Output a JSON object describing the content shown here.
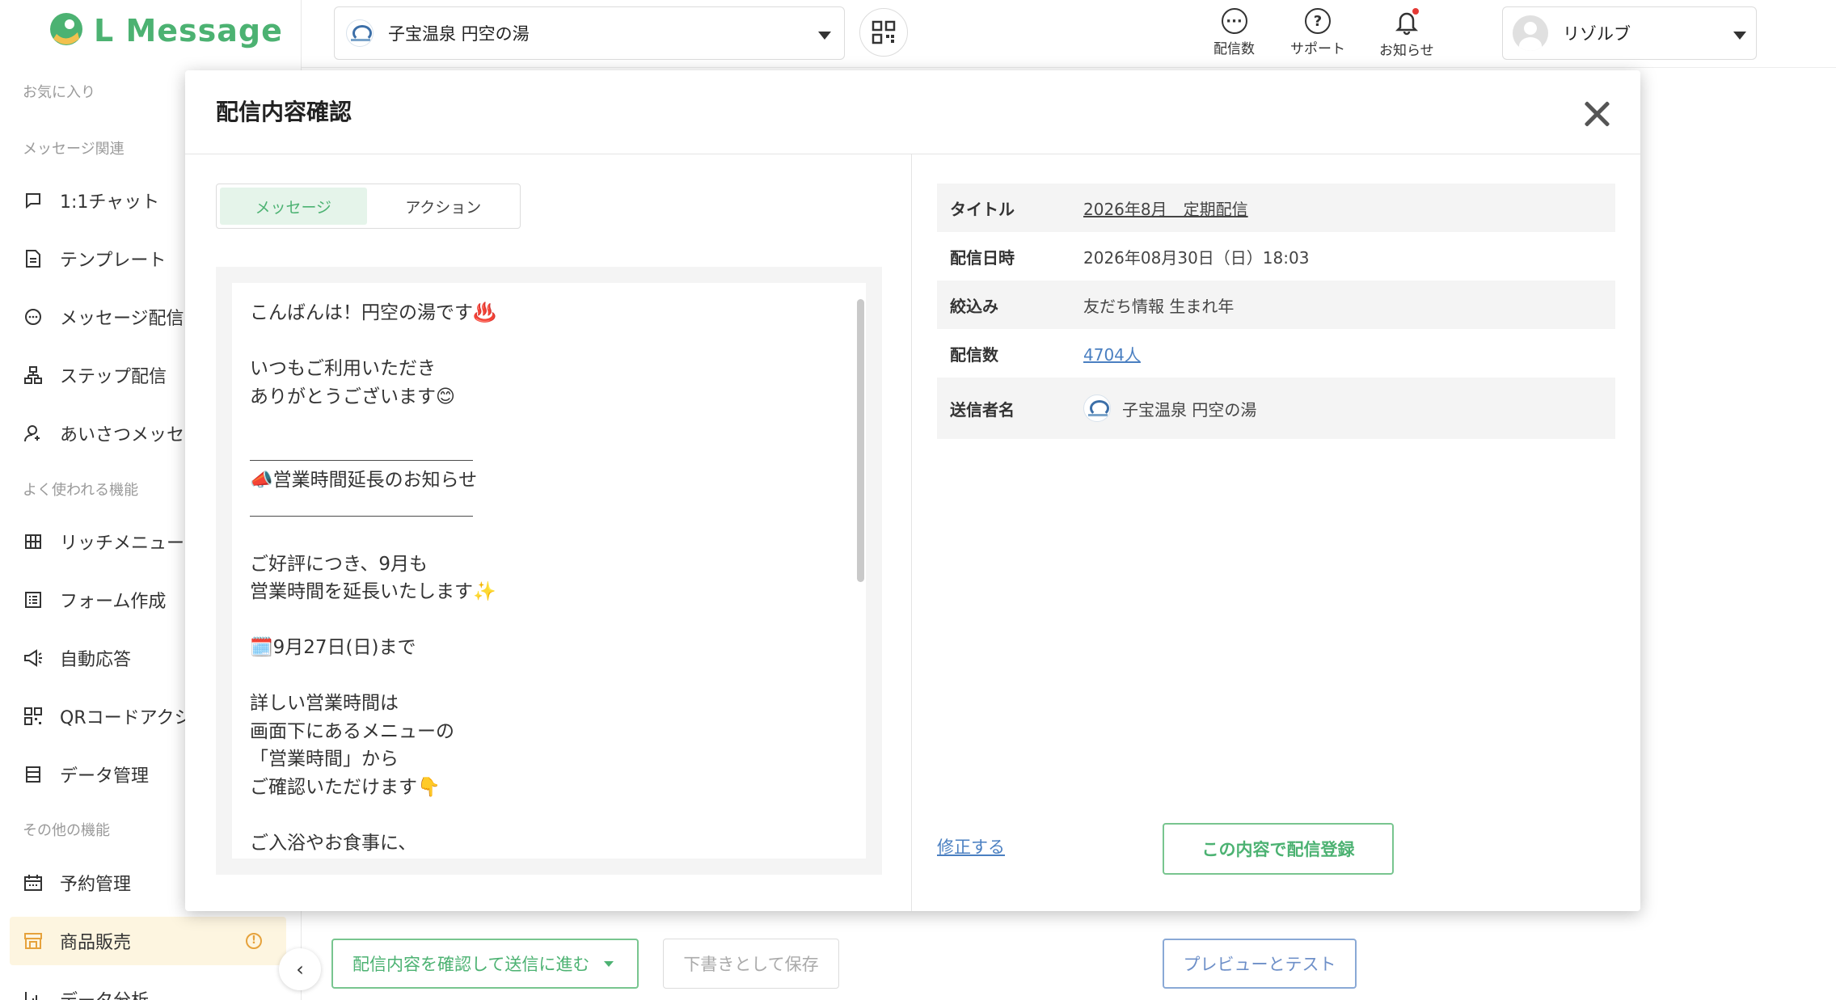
{
  "app": {
    "logo_text": "L Message",
    "brand_color": "#4cb272"
  },
  "sidebar": {
    "sections": {
      "favorites": "お気に入り",
      "message_related": "メッセージ関連",
      "frequent": "よく使われる機能",
      "other": "その他の機能"
    },
    "items": [
      {
        "label": "1:1チャット",
        "icon": "chat-icon"
      },
      {
        "label": "テンプレート",
        "icon": "document-icon"
      },
      {
        "label": "メッセージ配信",
        "icon": "message-bubble-icon"
      },
      {
        "label": "ステップ配信",
        "icon": "step-tree-icon"
      },
      {
        "label": "あいさつメッセー",
        "icon": "person-icon"
      },
      {
        "label": "リッチメニュー",
        "icon": "grid-icon"
      },
      {
        "label": "フォーム作成",
        "icon": "form-icon"
      },
      {
        "label": "自動応答",
        "icon": "megaphone-icon"
      },
      {
        "label": "QRコードアクシ",
        "icon": "qr-icon"
      },
      {
        "label": "データ管理",
        "icon": "database-icon"
      },
      {
        "label": "予約管理",
        "icon": "calendar-icon"
      },
      {
        "label": "商品販売",
        "icon": "shop-icon",
        "active": true
      },
      {
        "label": "データ分析",
        "icon": "chart-icon"
      }
    ]
  },
  "header": {
    "account_name": "子宝温泉 円空の湯",
    "icons": {
      "send_count": "配信数",
      "support": "サポート",
      "notifications": "お知らせ"
    },
    "user_name": "リゾルブ"
  },
  "bottom_bar": {
    "confirm_label": "配信内容を確認して送信に進む",
    "draft_label": "下書きとして保存",
    "preview_label": "プレビューとテスト"
  },
  "modal": {
    "title": "配信内容確認",
    "tabs": [
      "メッセージ",
      "アクション"
    ],
    "active_tab": "メッセージ",
    "message_text": "こんばんは！円空の湯です♨️\n\nいつもご利用いただき\nありがとうございます😊\n\n＿＿＿＿＿＿＿＿＿＿＿＿\n📣営業時間延長のお知らせ\n＿＿＿＿＿＿＿＿＿＿＿＿\n\nご好評につき、9月も\n営業時間を延長いたします✨\n\n🗓️9月27日(日)まで\n\n詳しい営業時間は\n画面下にあるメニューの\n「営業時間」から\nご確認いただけます👇\n\nご入浴やお食事に、\nぜひご利用ください",
    "details": {
      "title_label": "タイトル",
      "title_value": "2026年8月　定期配信",
      "date_label": "配信日時",
      "date_value": "2026年08月30日（日）18:03",
      "filter_label": "絞込み",
      "filter_value": "友だち情報 生まれ年",
      "count_label": "配信数",
      "count_value": "4704人",
      "sender_label": "送信者名",
      "sender_value": "子宝温泉 円空の湯"
    },
    "edit_label": "修正する",
    "register_label": "この内容で配信登録"
  }
}
